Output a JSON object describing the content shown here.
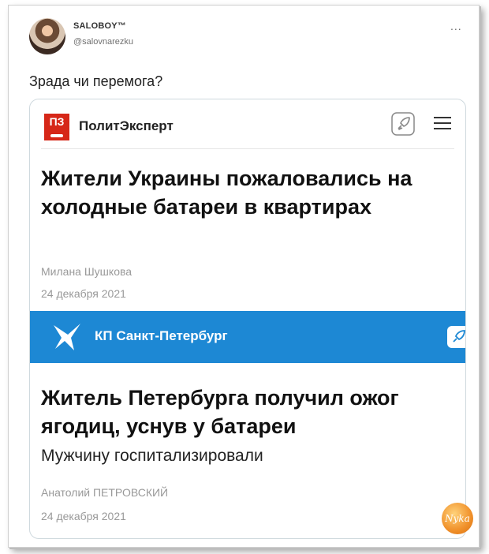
{
  "tweet": {
    "author_name": "SALOBOY™",
    "author_handle": "@salovnarezku",
    "more_label": "...",
    "text": "Зрада чи перемога?"
  },
  "card1": {
    "logo_text": "ПЗ",
    "site_name": "ПолитЭксперт",
    "headline": "Жители Украины пожаловались на холодные батареи в квартирах",
    "author": "Милана Шушкова",
    "date": "24 декабря 2021"
  },
  "card2": {
    "site_name": "КП Санкт-Петербург",
    "headline": "Житель Петербурга получил ожог ягодиц, уснув у батареи",
    "subheadline": "Мужчину госпитализировали",
    "author": "Анатолий ПЕТРОВСКИЙ",
    "date": "24 декабря 2021"
  },
  "watermark": {
    "text": "Nyka"
  },
  "colors": {
    "pe_red": "#d62718",
    "kp_blue": "#1d88d4"
  },
  "icons": [
    "rocket-icon",
    "menu-icon",
    "kp-bird-logo"
  ]
}
